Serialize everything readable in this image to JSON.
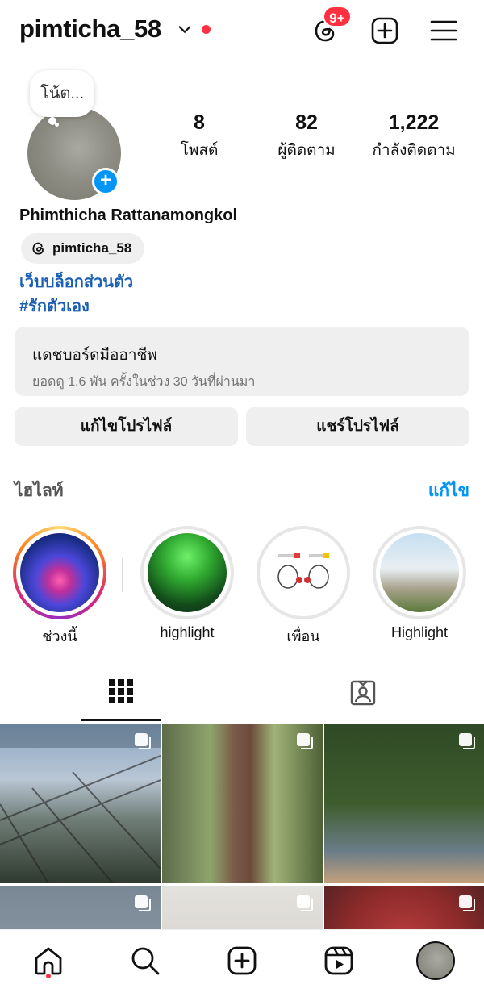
{
  "header": {
    "username": "pimticha_58",
    "notification_badge": "9+"
  },
  "profile": {
    "note": "โน้ต...",
    "stats": {
      "posts": {
        "value": "8",
        "label": "โพสต์"
      },
      "followers": {
        "value": "82",
        "label": "ผู้ติดตาม"
      },
      "following": {
        "value": "1,222",
        "label": "กำลังติดตาม"
      }
    },
    "full_name": "Phimthicha Rattanamongkol",
    "threads_handle": "pimticha_58",
    "bio_links": [
      "เว็บบล็อกส่วนตัว",
      "#รักตัวเอง"
    ]
  },
  "dashboard": {
    "title": "แดชบอร์ดมืออาชีพ",
    "subtitle": "ยอดดู 1.6 พัน ครั้งในช่วง 30 วันที่ผ่านมา"
  },
  "buttons": {
    "edit_profile": "แก้ไขโปรไฟล์",
    "share_profile": "แชร์โปรไฟล์"
  },
  "highlights": {
    "title": "ไฮไลท์",
    "edit": "แก้ไข",
    "items": [
      {
        "label": "ช่วงนี้"
      },
      {
        "label": "highlight"
      },
      {
        "label": "เพื่อน"
      },
      {
        "label": "Highlight"
      }
    ]
  },
  "colors": {
    "accent": "#0095f6",
    "link": "#1a5fb4",
    "badge": "#ff3040",
    "button_bg": "#efefef"
  },
  "icons": {
    "header": [
      "threads-icon",
      "create-post-icon",
      "menu-icon"
    ],
    "tabs": [
      "grid-icon",
      "tagged-icon"
    ],
    "nav": [
      "home-icon",
      "search-icon",
      "create-icon",
      "reels-icon",
      "profile-avatar"
    ]
  }
}
